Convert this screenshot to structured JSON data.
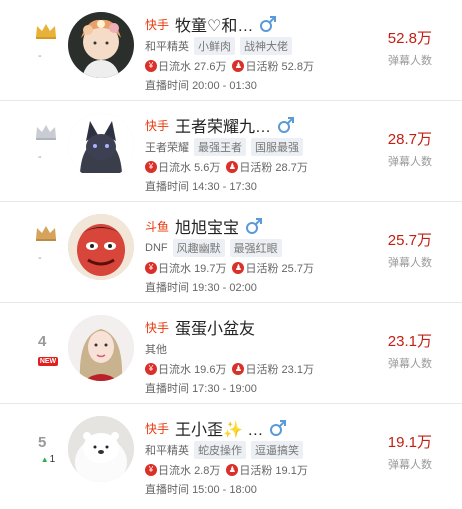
{
  "accent_color": "#c21f14",
  "platform_color": "#e8390c",
  "rows": [
    {
      "rank_icon": "crown-gold-icon",
      "rank_change": "-",
      "platform": "快手",
      "name": "牧童♡和…",
      "gender_icon": "male-icon",
      "category": "和平精英",
      "tags": [
        "小鲜肉",
        "战神大佬"
      ],
      "revenue_label": "日流水",
      "revenue": "27.6万",
      "fans_label": "日活粉",
      "fans": "52.8万",
      "time_label": "直播时间",
      "time": "20:00 - 01:30",
      "value": "52.8万",
      "value_label": "弹幕人数"
    },
    {
      "rank_icon": "crown-silver-icon",
      "rank_change": "-",
      "platform": "快手",
      "name": "王者荣耀九…",
      "gender_icon": "male-icon",
      "category": "王者荣耀",
      "tags": [
        "最强王者",
        "国服最强"
      ],
      "revenue_label": "日流水",
      "revenue": "5.6万",
      "fans_label": "日活粉",
      "fans": "28.7万",
      "time_label": "直播时间",
      "time": "14:30 - 17:30",
      "value": "28.7万",
      "value_label": "弹幕人数"
    },
    {
      "rank_icon": "crown-bronze-icon",
      "rank_change": "-",
      "platform": "斗鱼",
      "name": "旭旭宝宝",
      "gender_icon": "male-icon",
      "category": "DNF",
      "tags": [
        "风趣幽默",
        "最强红眼"
      ],
      "revenue_label": "日流水",
      "revenue": "19.7万",
      "fans_label": "日活粉",
      "fans": "25.7万",
      "time_label": "直播时间",
      "time": "19:30 - 02:00",
      "value": "25.7万",
      "value_label": "弹幕人数"
    },
    {
      "rank_number": "4",
      "rank_badge": "NEW",
      "platform": "快手",
      "name": "蛋蛋小盆友",
      "category": "其他",
      "tags": [],
      "revenue_label": "日流水",
      "revenue": "19.6万",
      "fans_label": "日活粉",
      "fans": "23.1万",
      "time_label": "直播时间",
      "time": "17:30 - 19:00",
      "value": "23.1万",
      "value_label": "弹幕人数"
    },
    {
      "rank_number": "5",
      "rank_change": "1",
      "platform": "快手",
      "name": "王小歪✨ …",
      "gender_icon": "male-icon",
      "category": "和平精英",
      "tags": [
        "蛇皮操作",
        "逗逼搞笑"
      ],
      "revenue_label": "日流水",
      "revenue": "2.8万",
      "fans_label": "日活粉",
      "fans": "19.1万",
      "time_label": "直播时间",
      "time": "15:00 - 18:00",
      "value": "19.1万",
      "value_label": "弹幕人数"
    }
  ]
}
